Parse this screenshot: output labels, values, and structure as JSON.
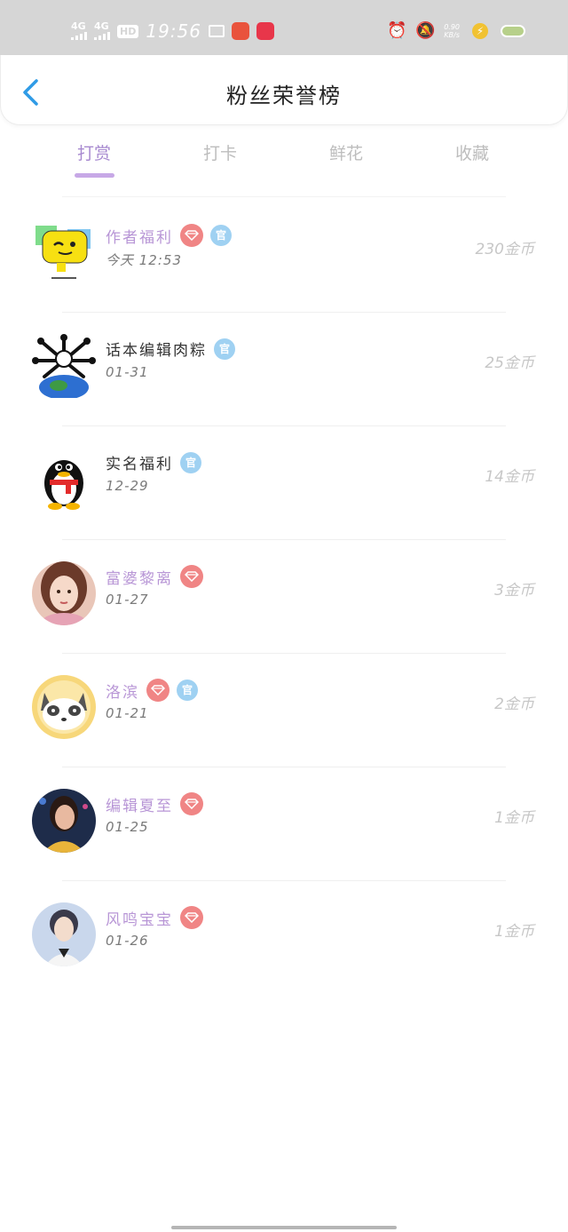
{
  "status_bar": {
    "net1": "4G",
    "net2": "4G",
    "hd": "HD",
    "time": "19:56",
    "speed_value": "0.90",
    "speed_unit": "KB/s"
  },
  "header": {
    "title": "粉丝荣誉榜"
  },
  "tabs": [
    {
      "label": "打赏",
      "active": true
    },
    {
      "label": "打卡",
      "active": false
    },
    {
      "label": "鲜花",
      "active": false
    },
    {
      "label": "收藏",
      "active": false
    }
  ],
  "badges": {
    "guan": "官"
  },
  "rows": [
    {
      "name": "作者福利",
      "date": "今天 12:53",
      "amount": "230金币",
      "vip": true,
      "guan": true,
      "avatar": "emoji-avatar"
    },
    {
      "name": "话本编辑肉粽",
      "date": "01-31",
      "amount": "25金币",
      "vip": false,
      "guan": true,
      "avatar": "skull-earth-avatar"
    },
    {
      "name": "实名福利",
      "date": "12-29",
      "amount": "14金币",
      "vip": false,
      "guan": true,
      "avatar": "penguin-avatar"
    },
    {
      "name": "富婆黎离",
      "date": "01-27",
      "amount": "3金币",
      "vip": true,
      "guan": false,
      "avatar": "girl-portrait-avatar"
    },
    {
      "name": "洛滨",
      "date": "01-21",
      "amount": "2金币",
      "vip": true,
      "guan": true,
      "avatar": "cat-avatar"
    },
    {
      "name": "编辑夏至",
      "date": "01-25",
      "amount": "1金币",
      "vip": true,
      "guan": false,
      "avatar": "woman-photo-avatar"
    },
    {
      "name": "风鸣宝宝",
      "date": "01-26",
      "amount": "1金币",
      "vip": true,
      "guan": false,
      "avatar": "man-photo-avatar"
    }
  ],
  "colors": {
    "accent": "#a88ad0",
    "vip_name": "#b896d6",
    "vip_badge": "#f08585",
    "guan_badge": "#9fd1f2",
    "back_arrow": "#2f9be6"
  }
}
